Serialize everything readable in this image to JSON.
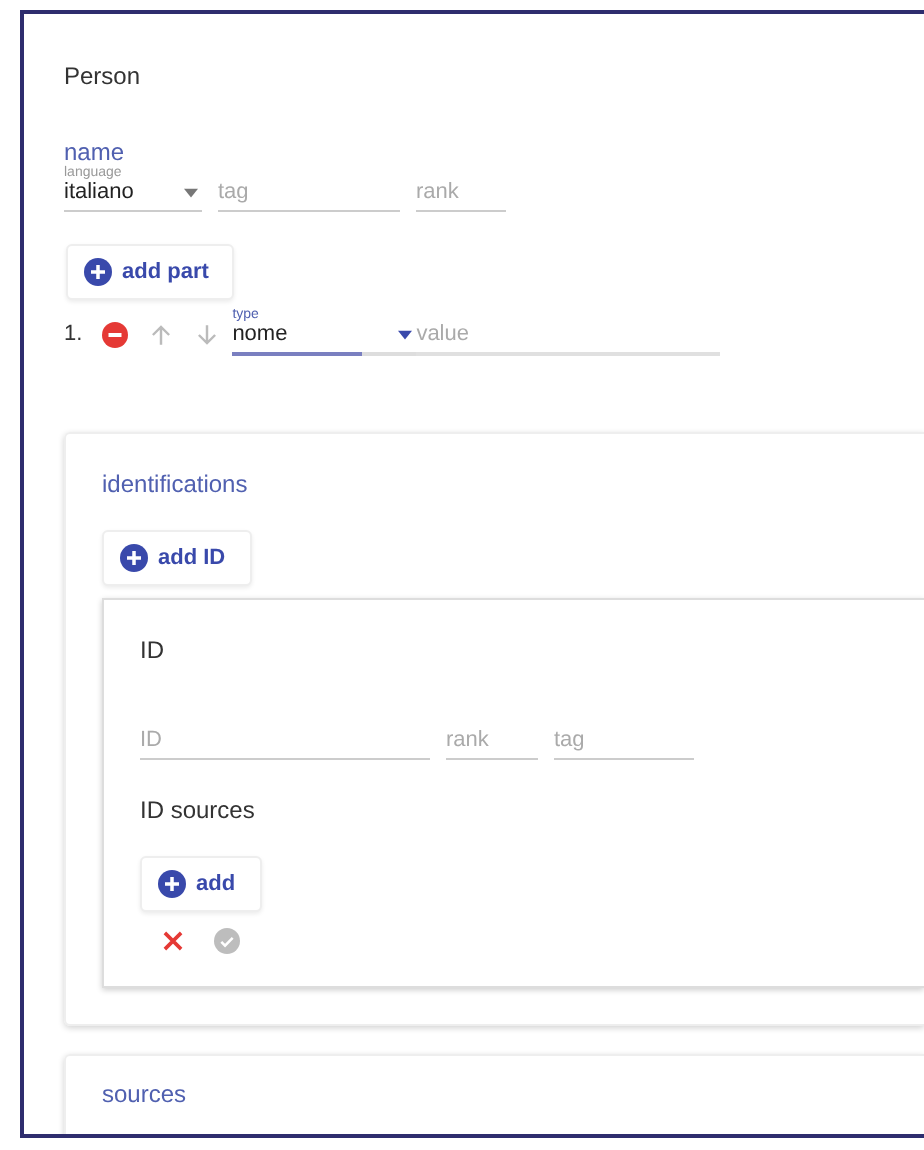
{
  "title": "Person",
  "name": {
    "heading": "name",
    "language": {
      "label": "language",
      "value": "italiano"
    },
    "tag": {
      "placeholder": "tag"
    },
    "rank": {
      "placeholder": "rank"
    },
    "add_part": "add part",
    "parts": [
      {
        "number": "1.",
        "type_label": "type",
        "type_value": "nome",
        "value": {
          "placeholder": "value"
        }
      }
    ]
  },
  "identifications": {
    "heading": "identifications",
    "add_button": "add ID",
    "ids": [
      {
        "heading": "ID",
        "id": {
          "placeholder": "ID"
        },
        "rank": {
          "placeholder": "rank"
        },
        "tag": {
          "placeholder": "tag"
        },
        "sources_heading": "ID sources",
        "add_button": "add",
        "save_disabled": true
      }
    ]
  },
  "sources": {
    "heading": "sources"
  }
}
